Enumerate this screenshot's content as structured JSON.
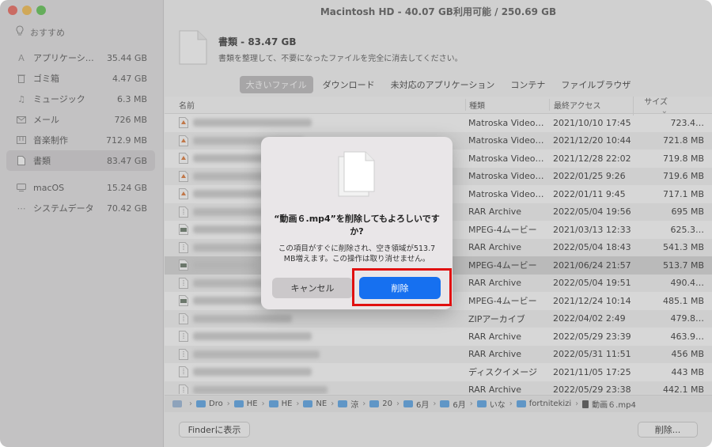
{
  "window_title": "Macintosh HD - 40.07 GB利用可能 / 250.69 GB",
  "sidebar": {
    "recommend": "おすすめ",
    "items": [
      {
        "label": "アプリケーシ…",
        "size": "35.44 GB",
        "icon": "apps-icon"
      },
      {
        "label": "ゴミ箱",
        "size": "4.47 GB",
        "icon": "trash-icon"
      },
      {
        "label": "ミュージック",
        "size": "6.3 MB",
        "icon": "music-icon"
      },
      {
        "label": "メール",
        "size": "726 MB",
        "icon": "mail-icon"
      },
      {
        "label": "音楽制作",
        "size": "712.9 MB",
        "icon": "music-creation-icon"
      },
      {
        "label": "書類",
        "size": "83.47 GB",
        "icon": "document-icon",
        "selected": true
      }
    ],
    "items2": [
      {
        "label": "macOS",
        "size": "15.24 GB",
        "icon": "macos-icon"
      },
      {
        "label": "システムデータ",
        "size": "70.42 GB",
        "icon": "system-data-icon"
      }
    ]
  },
  "header": {
    "title": "書類 - 83.47 GB",
    "description": "書類を整理して、不要になったファイルを完全に消去してください。"
  },
  "tabs": [
    "大きいファイル",
    "ダウンロード",
    "未対応のアプリケーション",
    "コンテナ",
    "ファイルブラウザ"
  ],
  "table": {
    "headers": {
      "name": "名前",
      "kind": "種類",
      "date": "最終アクセス",
      "size": "サイズ"
    },
    "rows": [
      {
        "kind": "Matroska Video…",
        "date": "2021/10/10 17:45",
        "size": "723.4…"
      },
      {
        "kind": "Matroska Video…",
        "date": "2021/12/20 10:44",
        "size": "721.8 MB"
      },
      {
        "kind": "Matroska Video…",
        "date": "2021/12/28 22:02",
        "size": "719.8 MB"
      },
      {
        "kind": "Matroska Video…",
        "date": "2022/01/25 9:26",
        "size": "719.6 MB"
      },
      {
        "kind": "Matroska Video…",
        "date": "2022/01/11 9:45",
        "size": "717.1 MB"
      },
      {
        "kind": "RAR Archive",
        "date": "2022/05/04 19:56",
        "size": "695 MB"
      },
      {
        "kind": "MPEG-4ムービー",
        "date": "2021/03/13 12:33",
        "size": "625.3…"
      },
      {
        "kind": "RAR Archive",
        "date": "2022/05/04 18:43",
        "size": "541.3 MB"
      },
      {
        "kind": "MPEG-4ムービー",
        "date": "2021/06/24 21:57",
        "size": "513.7 MB",
        "selected": true
      },
      {
        "kind": "RAR Archive",
        "date": "2022/05/04 19:51",
        "size": "490.4…"
      },
      {
        "kind": "MPEG-4ムービー",
        "date": "2021/12/24 10:14",
        "size": "485.1 MB"
      },
      {
        "kind": "ZIPアーカイブ",
        "date": "2022/04/02 2:49",
        "size": "479.8…"
      },
      {
        "kind": "RAR Archive",
        "date": "2022/05/29 23:39",
        "size": "463.9…"
      },
      {
        "kind": "RAR Archive",
        "date": "2022/05/31 11:51",
        "size": "456 MB"
      },
      {
        "kind": "ディスクイメージ",
        "date": "2021/11/05 17:25",
        "size": "443 MB"
      },
      {
        "kind": "RAR Archive",
        "date": "2022/05/29 23:38",
        "size": "442.1 MB"
      }
    ]
  },
  "pathbar": [
    "Dro",
    "HE",
    "HE",
    "NE",
    "涼",
    "20",
    "6月",
    "6月",
    "いな",
    "fortnitekizi",
    "動画６.mp4"
  ],
  "buttons": {
    "show_in_finder": "Finderに表示",
    "delete": "削除..."
  },
  "dialog": {
    "title": "“動画６.mp4”を削除してもよろしいですか?",
    "message": "この項目がすぐに削除され、空き領域が513.7 MB増えます。この操作は取り消せません。",
    "cancel": "キャンセル",
    "confirm": "削除"
  },
  "colors": {
    "accent": "#1670f0",
    "highlight": "#e01010"
  }
}
